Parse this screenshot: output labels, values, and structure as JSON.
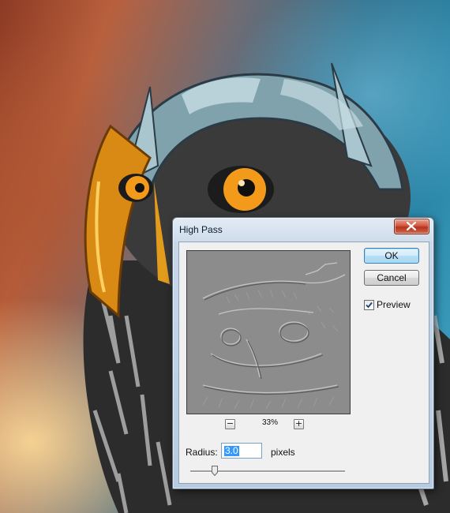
{
  "dialog": {
    "title": "High Pass",
    "ok_label": "OK",
    "cancel_label": "Cancel",
    "preview_checkbox": {
      "label": "Preview",
      "checked": true
    },
    "zoom": {
      "value": "33%",
      "zoom_out_icon": "minus",
      "zoom_in_icon": "plus"
    },
    "radius": {
      "label": "Radius:",
      "value": "3.0",
      "units": "pixels"
    },
    "slider_fraction": 0.16
  },
  "colors": {
    "background_warm": "#b9603d",
    "background_cool": "#2a86a8",
    "owl_eye": "#f39a1a",
    "close_button": "#c8452b",
    "selection": "#3399ff"
  }
}
